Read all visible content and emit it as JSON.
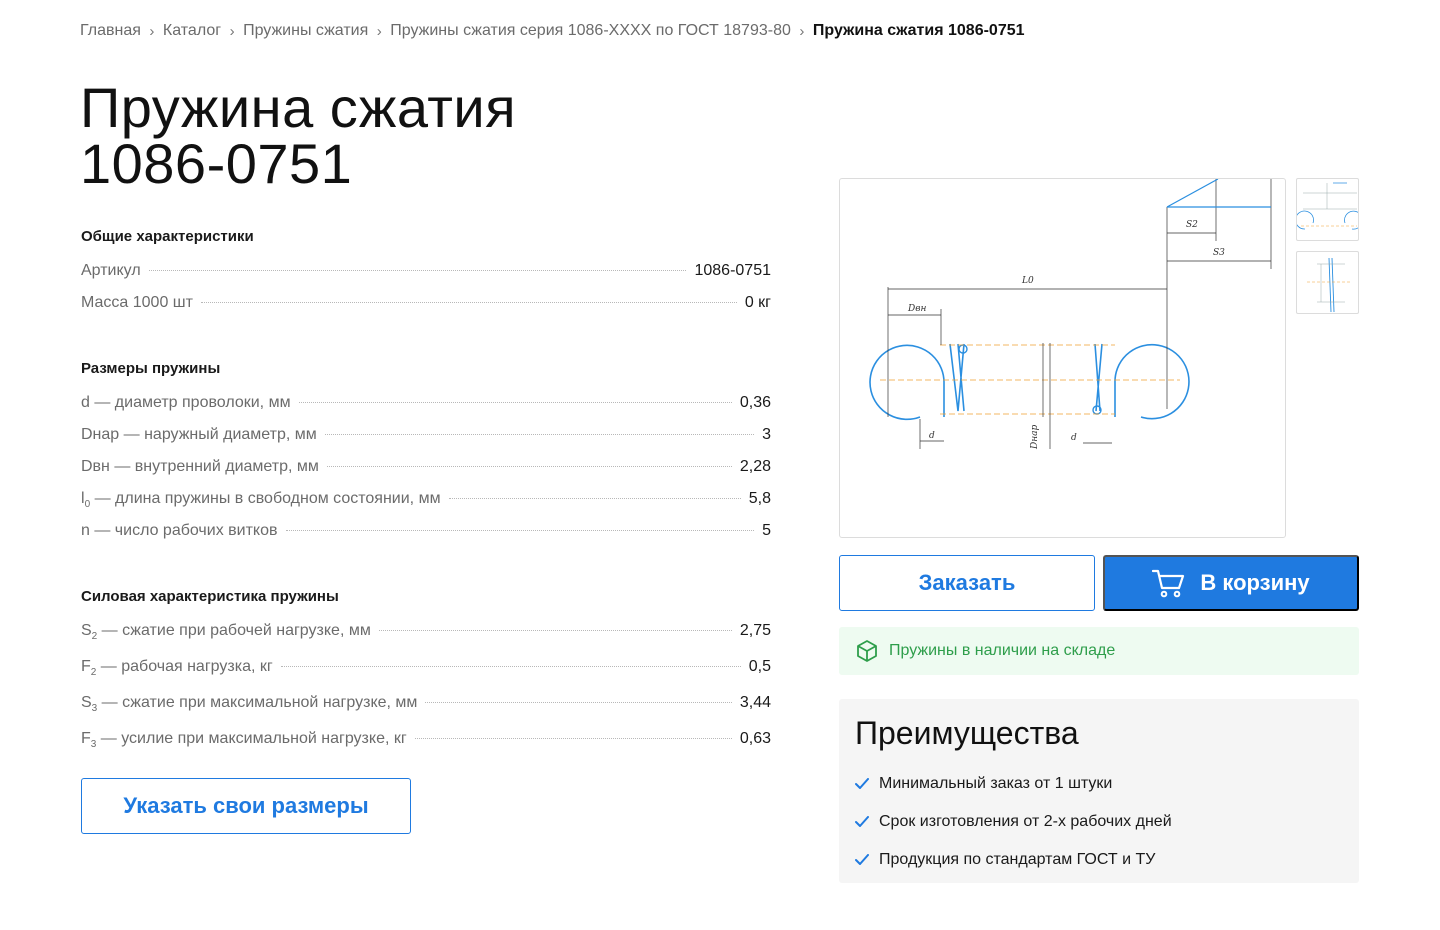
{
  "breadcrumb": {
    "items": [
      "Главная",
      "Каталог",
      "Пружины сжатия",
      "Пружины сжатия серия 1086-XXXX по ГОСТ 18793-80"
    ],
    "current": "Пружина сжатия 1086-0751",
    "separator": ">"
  },
  "title_line1": "Пружина сжатия",
  "title_line2": "1086-0751",
  "general": {
    "heading": "Общие характеристики",
    "rows": [
      {
        "label": "Артикул",
        "value": "1086-0751"
      },
      {
        "label": "Масса 1000 шт",
        "value": "0 кг"
      }
    ]
  },
  "sizes": {
    "heading": "Размеры пружины",
    "rows": [
      {
        "label": "d — диаметр проволоки, мм",
        "value": "0,36"
      },
      {
        "label": "Dнар — наружный диаметр, мм",
        "value": "3"
      },
      {
        "label": "Dвн — внутренний диаметр, мм",
        "value": "2,28"
      },
      {
        "label_main": "l",
        "label_sub": "0",
        "label_rest": " — длина пружины в свободном состоянии, мм",
        "value": "5,8"
      },
      {
        "label": "n — число рабочих витков",
        "value": "5"
      }
    ]
  },
  "force": {
    "heading": "Силовая характеристика пружины",
    "rows": [
      {
        "label_main": "S",
        "label_sub": "2",
        "label_rest": " — сжатие при рабочей нагрузке, мм",
        "value": "2,75"
      },
      {
        "label_main": "F",
        "label_sub": "2",
        "label_rest": " — рабочая нагрузка, кг",
        "value": "0,5"
      },
      {
        "label_main": "S",
        "label_sub": "3",
        "label_rest": " — сжатие при максимальной нагрузке, мм",
        "value": "3,44"
      },
      {
        "label_main": "F",
        "label_sub": "3",
        "label_rest": " — усилие при максимальной нагрузке, кг",
        "value": "0,63"
      }
    ]
  },
  "custom_size_button": "Указать свои размеры",
  "drawing": {
    "labels": {
      "L0": "L0",
      "Dvn": "Dвн",
      "S2": "S2",
      "S3": "S3",
      "d": "d",
      "Dnar": "Dнар",
      "d2": "d"
    }
  },
  "order_button": "Заказать",
  "cart_button": "В корзину",
  "stock_text": "Пружины в наличии на складе",
  "advantages": {
    "heading": "Преимущества",
    "items": [
      "Минимальный заказ от 1 штуки",
      "Срок изготовления от 2-х рабочих дней",
      "Продукция по стандартам ГОСТ и ТУ"
    ]
  },
  "icons": {
    "breadcrumb_sep": "chevron-right-icon",
    "cart": "cart-icon",
    "stock": "box-icon",
    "check": "check-icon"
  },
  "colors": {
    "accent": "#1f7ae0",
    "stock_green": "#2e9e4b",
    "stock_bg": "#eefbf1",
    "drawing_blue": "#2b8fe0",
    "drawing_orange": "#f0a030"
  }
}
